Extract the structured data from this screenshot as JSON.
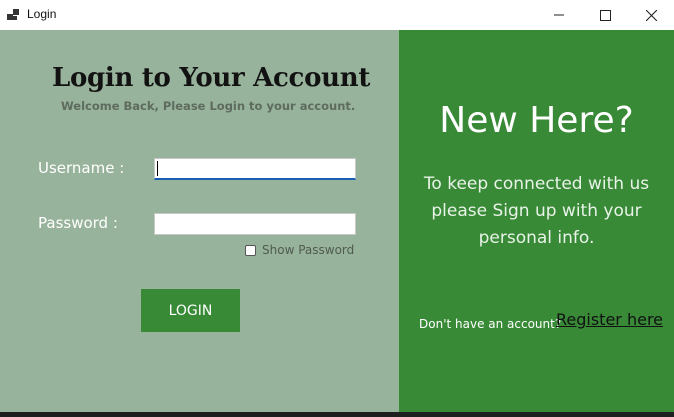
{
  "window": {
    "title": "Login",
    "controls": [
      "minimize-icon",
      "maximize-icon",
      "close-icon"
    ]
  },
  "left": {
    "heading": "Login to Your Account",
    "subheading": "Welcome Back, Please Login to your account.",
    "username_label": "Username :",
    "username_value": "",
    "password_label": "Password :",
    "password_value": "",
    "show_password_label": "Show Password",
    "show_password_checked": false,
    "login_button": "LOGIN"
  },
  "right": {
    "title": "New Here?",
    "message": "To keep connected with us please Sign up with your personal info.",
    "no_account_text": "Don't have an account?",
    "register_link": "Register here"
  },
  "colors": {
    "left_bg": "#98b39b",
    "right_bg": "#388a37",
    "button_bg": "#388a37"
  }
}
